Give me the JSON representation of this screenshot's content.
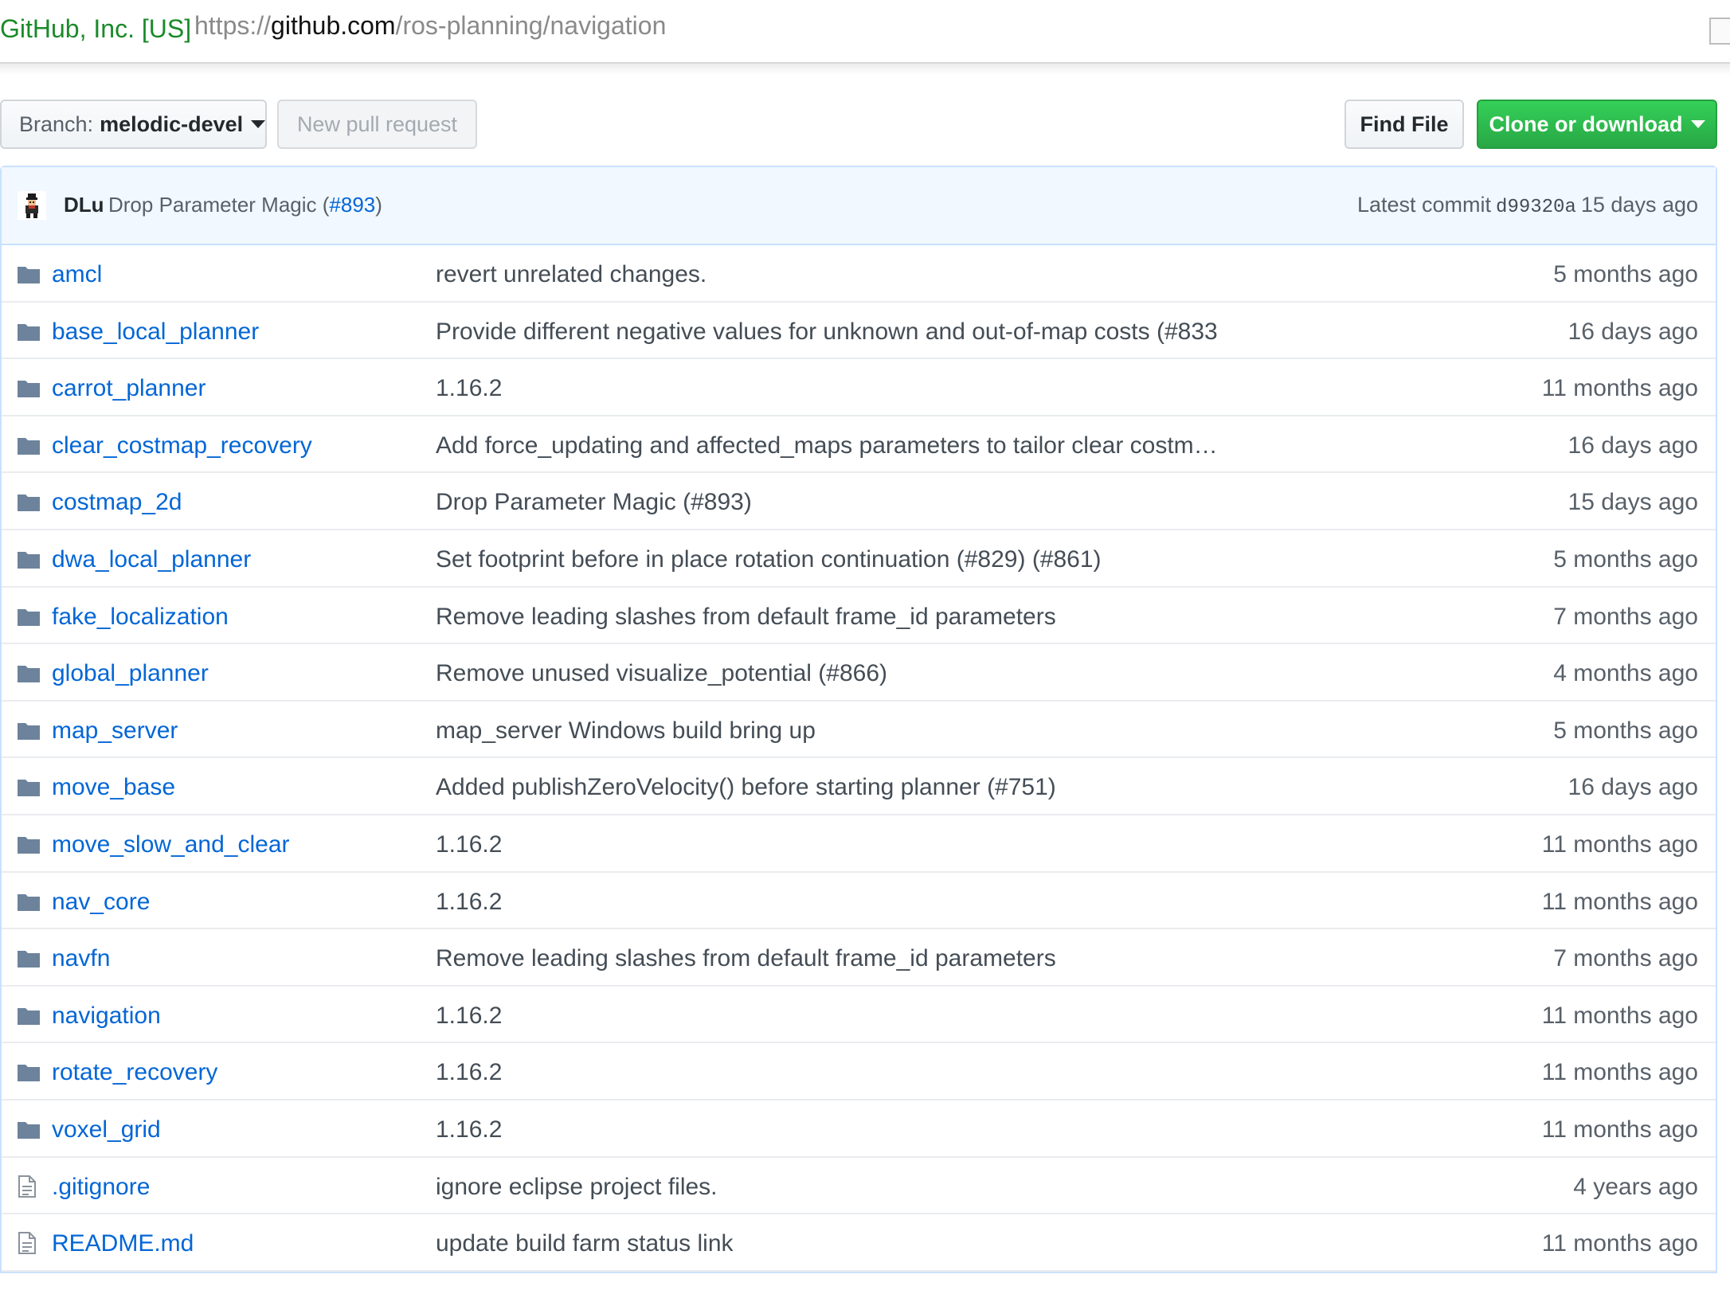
{
  "address_bar": {
    "certificate": "GitHub, Inc. [US]",
    "url_scheme": "https://",
    "url_host": "github.com",
    "url_path": "/ros-planning/navigation"
  },
  "toolbar": {
    "branch_label": "Branch:",
    "branch_value": "melodic-devel",
    "new_pr_label": "New pull request",
    "find_file_label": "Find File",
    "clone_label": "Clone or download"
  },
  "latest_commit": {
    "author": "DLu",
    "message": "Drop Parameter Magic (",
    "pr_ref": "#893",
    "message_end": ")",
    "label": "Latest commit",
    "sha": "d99320a",
    "age": "15 days ago"
  },
  "files": [
    {
      "type": "dir",
      "name": "amcl",
      "message": "revert unrelated changes.",
      "age": "5 months ago"
    },
    {
      "type": "dir",
      "name": "base_local_planner",
      "message": "Provide different negative values for unknown and out-of-map costs (#833",
      "age": "16 days ago"
    },
    {
      "type": "dir",
      "name": "carrot_planner",
      "message": "1.16.2",
      "age": "11 months ago"
    },
    {
      "type": "dir",
      "name": "clear_costmap_recovery",
      "message": "Add force_updating and affected_maps parameters to tailor clear costm…",
      "age": "16 days ago"
    },
    {
      "type": "dir",
      "name": "costmap_2d",
      "message": "Drop Parameter Magic (#893)",
      "age": "15 days ago"
    },
    {
      "type": "dir",
      "name": "dwa_local_planner",
      "message": "Set footprint before in place rotation continuation (#829) (#861)",
      "age": "5 months ago"
    },
    {
      "type": "dir",
      "name": "fake_localization",
      "message": "Remove leading slashes from default frame_id parameters",
      "age": "7 months ago"
    },
    {
      "type": "dir",
      "name": "global_planner",
      "message": "Remove unused visualize_potential (#866)",
      "age": "4 months ago"
    },
    {
      "type": "dir",
      "name": "map_server",
      "message": "map_server Windows build bring up",
      "age": "5 months ago"
    },
    {
      "type": "dir",
      "name": "move_base",
      "message": "Added publishZeroVelocity() before starting planner (#751)",
      "age": "16 days ago"
    },
    {
      "type": "dir",
      "name": "move_slow_and_clear",
      "message": "1.16.2",
      "age": "11 months ago"
    },
    {
      "type": "dir",
      "name": "nav_core",
      "message": "1.16.2",
      "age": "11 months ago"
    },
    {
      "type": "dir",
      "name": "navfn",
      "message": "Remove leading slashes from default frame_id parameters",
      "age": "7 months ago"
    },
    {
      "type": "dir",
      "name": "navigation",
      "message": "1.16.2",
      "age": "11 months ago"
    },
    {
      "type": "dir",
      "name": "rotate_recovery",
      "message": "1.16.2",
      "age": "11 months ago"
    },
    {
      "type": "dir",
      "name": "voxel_grid",
      "message": "1.16.2",
      "age": "11 months ago"
    },
    {
      "type": "file",
      "name": ".gitignore",
      "message": "ignore eclipse project files.",
      "age": "4 years ago"
    },
    {
      "type": "file",
      "name": "README.md",
      "message": "update build farm status link",
      "age": "11 months ago"
    }
  ],
  "icons": {
    "directory": "folder-icon",
    "file": "file-icon"
  },
  "colors": {
    "link": "#0366d6",
    "clone_button": "#28a745",
    "commit_bar": "#f1f8ff",
    "cert_text": "#1a8a2a"
  }
}
